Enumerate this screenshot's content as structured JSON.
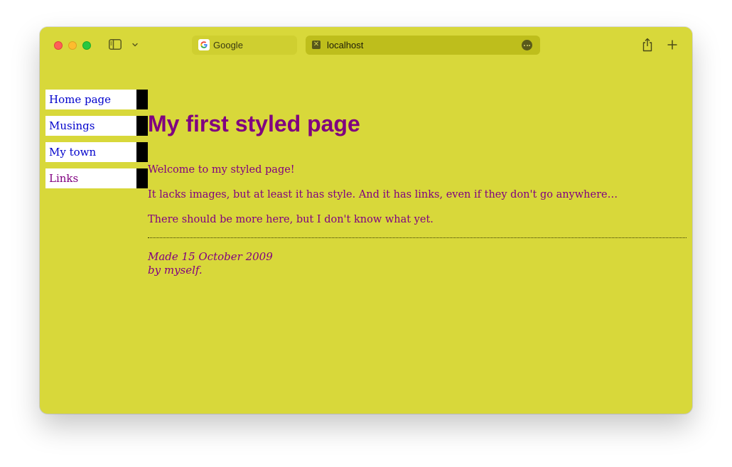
{
  "browser": {
    "tabs": [
      {
        "label": "Google",
        "favicon": "google-favicon"
      },
      {
        "label": "localhost",
        "favicon": "broken-page-favicon"
      }
    ],
    "theme_color": "#d8d83a"
  },
  "page": {
    "nav": [
      {
        "label": "Home page",
        "visited": false
      },
      {
        "label": "Musings",
        "visited": false
      },
      {
        "label": "My town",
        "visited": false
      },
      {
        "label": "Links",
        "visited": true
      }
    ],
    "heading": "My first styled page",
    "paragraphs": [
      "Welcome to my styled page!",
      "It lacks images, but at least it has style. And it has links, even if they don't go anywhere…",
      "There should be more here, but I don't know what yet."
    ],
    "footer": {
      "line1": "Made 15 October 2009",
      "line2": "by myself."
    },
    "colors": {
      "background": "#d8d83a",
      "text": "#800080",
      "link": "#0000cc",
      "visited_link": "#800080",
      "nav_bar": "#000000"
    }
  }
}
